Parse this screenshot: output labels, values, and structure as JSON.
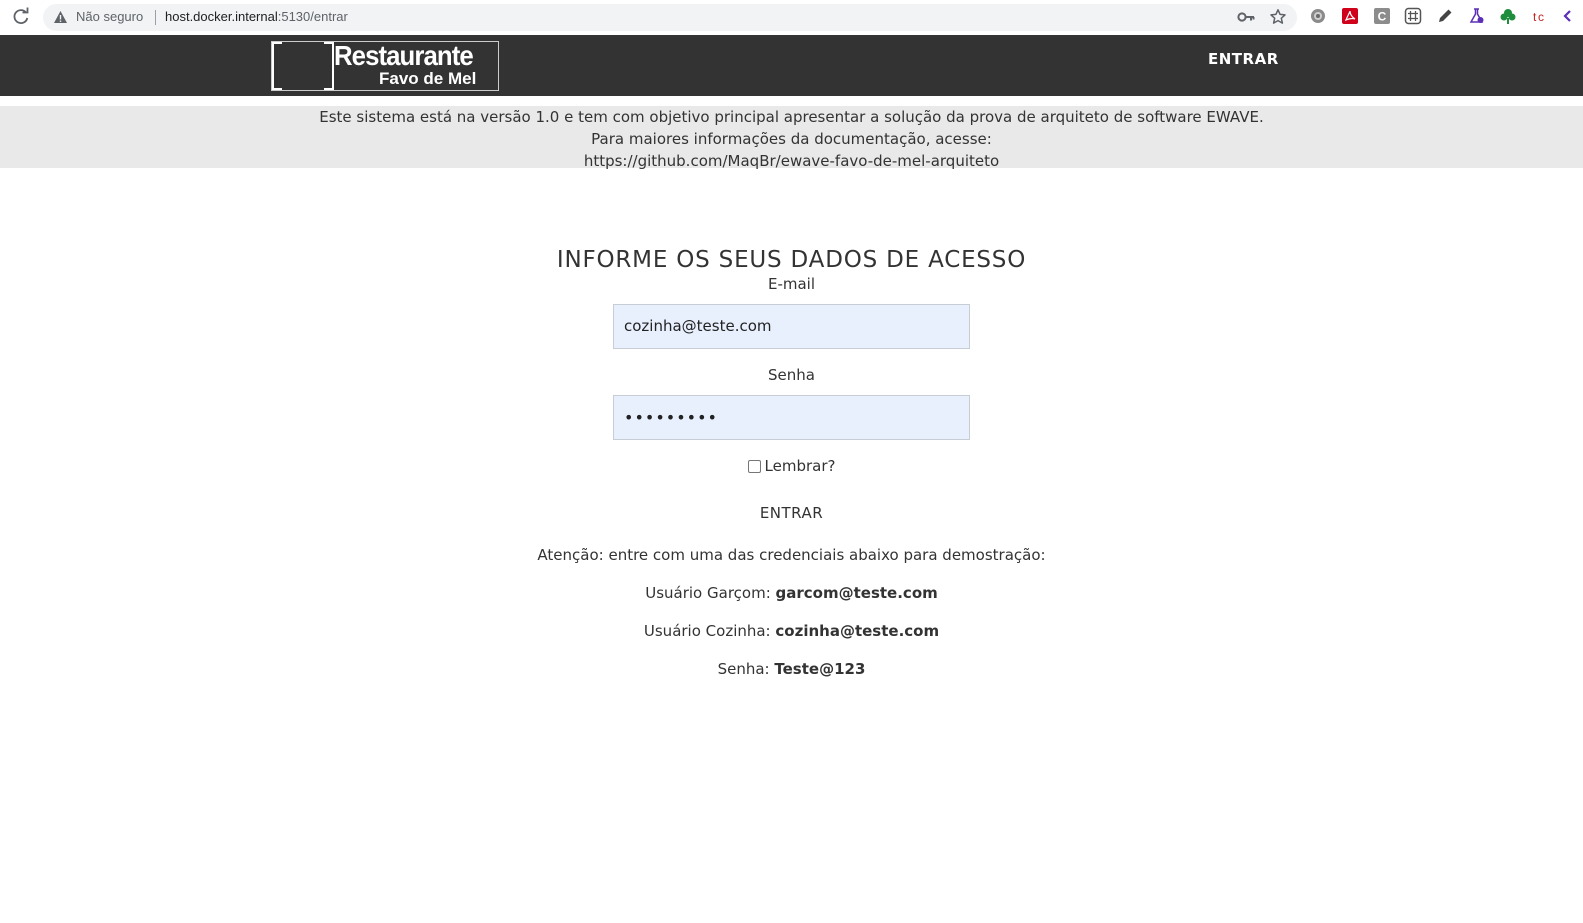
{
  "browser": {
    "security_label": "Não seguro",
    "url_host": "host.docker.internal",
    "url_path": ":5130/entrar",
    "extensions": [
      "settings-gear-icon",
      "pdf-icon",
      "c-letter-icon",
      "grid-icon",
      "pencil-icon",
      "flask-icon",
      "tree-icon",
      "tag-icon"
    ]
  },
  "navbar": {
    "logo_line1": "Restaurante",
    "logo_line2": "Favo de Mel",
    "login_link": "ENTRAR",
    "background": "#333333"
  },
  "banner": {
    "line1": "Este sistema está na versão 1.0 e tem com objetivo principal apresentar a solução da prova de arquiteto de software EWAVE.",
    "line2": "Para maiores informações da documentação, acesse:",
    "line3": "https://github.com/MaqBr/ewave-favo-de-mel-arquiteto"
  },
  "login": {
    "heading": "INFORME OS SEUS DADOS DE ACESSO",
    "email_label": "E-mail",
    "email_value": "cozinha@teste.com",
    "password_label": "Senha",
    "password_value": "•••••••••",
    "remember_label": "Lembrar?",
    "remember_checked": false,
    "submit_label": "ENTRAR"
  },
  "demo": {
    "attention": "Atenção: entre com uma das credenciais abaixo para demostração:",
    "waiter_label": "Usuário Garçom:",
    "waiter_email": "garcom@teste.com",
    "kitchen_label": "Usuário Cozinha:",
    "kitchen_email": "cozinha@teste.com",
    "password_label": "Senha:",
    "password_value": "Teste@123"
  }
}
